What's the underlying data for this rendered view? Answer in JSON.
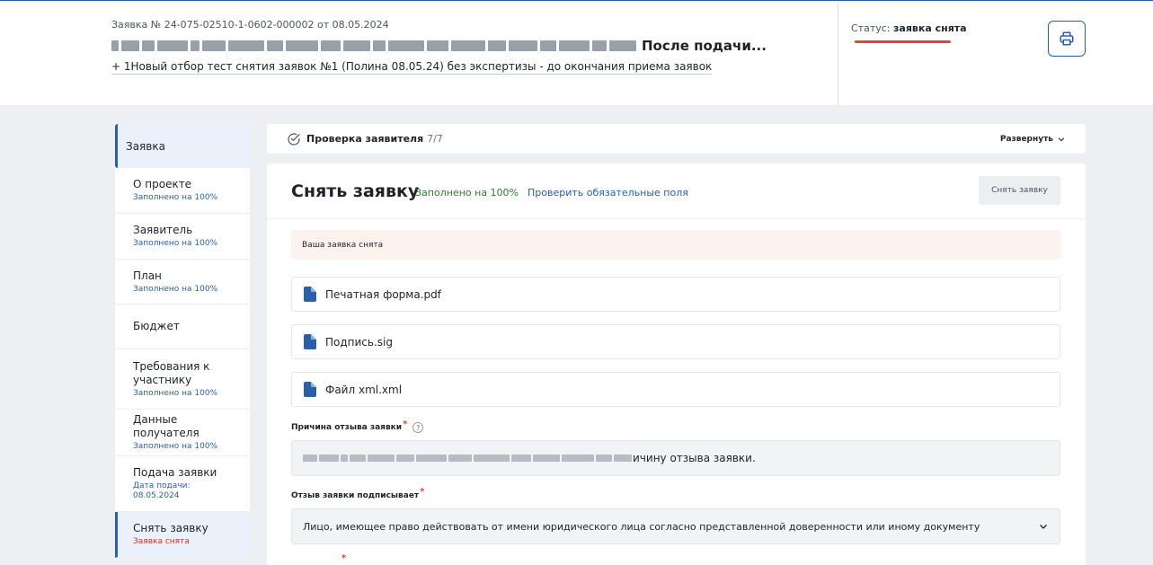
{
  "header": {
    "application_number": "Заявка № 24-075-02510-1-0602-000002 от 08.05.2024",
    "title_suffix": "После подачи...",
    "contest_link": "+ 1Новый отбор тест снятия заявок №1 (Полина 08.05.24) без экспертизы - до окончания приема заявок",
    "status_label": "Статус:",
    "status_value": "заявка снята",
    "status_color": "#e2452f",
    "print_icon": "printer-icon"
  },
  "sidebar": {
    "main_label": "Заявка",
    "items": [
      {
        "title": "О проекте",
        "sub": "Заполнено на 100%"
      },
      {
        "title": "Заявитель",
        "sub": "Заполнено на 100%"
      },
      {
        "title": "План",
        "sub": "Заполнено на 100%"
      },
      {
        "title": "Бюджет",
        "sub": ""
      },
      {
        "title": "Требования к участнику",
        "sub": "Заполнено на 100%"
      },
      {
        "title": "Данные получателя",
        "sub": "Заполнено на 100%"
      },
      {
        "title": "Подача заявки",
        "sub": "Дата подачи: 08.05.2024"
      },
      {
        "title": "Снять заявку",
        "sub": "Заявка снята"
      }
    ]
  },
  "check_bar": {
    "label": "Проверка заявителя",
    "count": "7/7",
    "expand_label": "Развернуть"
  },
  "panel": {
    "title": "Снять заявку",
    "fill_status": "Заполнено на 100%",
    "check_link": "Проверить обязательные поля",
    "withdraw_button": "Снять заявку",
    "notice": "Ваша заявка снята",
    "files": [
      {
        "name": "Печатная форма.pdf"
      },
      {
        "name": "Подпись.sig"
      },
      {
        "name": "Файл xml.xml"
      }
    ],
    "reason_label": "Причина отзыва заявки",
    "reason_value_visible": "ичину отзыва заявки.",
    "signer_label": "Отзыв заявки подписывает",
    "signer_value": "Лицо, имеющее право действовать от имени юридического лица согласно представленной доверенности или иному документу"
  },
  "colors": {
    "accent": "#2b5fa6",
    "success": "#2e7d32",
    "required": "#e2452f",
    "background": "#edeff3"
  }
}
